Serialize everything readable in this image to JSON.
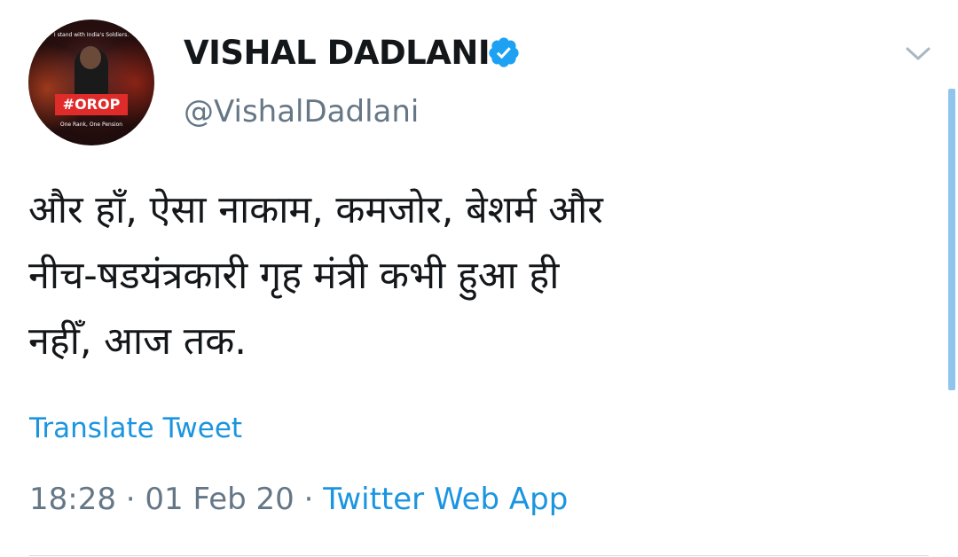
{
  "author": {
    "display_name": "VISHAL DADLANI",
    "handle": "@VishalDadlani",
    "verified": true,
    "avatar": {
      "banner_text": "I stand with India's Soldiers.",
      "tag": "#OROP",
      "subtitle": "One Rank, One Pension"
    }
  },
  "tweet": {
    "lines": [
      "और हाँ, ऐसा नाकाम, कमजोर, बेशर्म और",
      "नीच-षडयंत्रकारी गृह मंत्री कभी हुआ ही",
      "नहीँ, आज तक."
    ],
    "translate_label": "Translate Tweet",
    "time": "18:28",
    "date": "01 Feb 20",
    "separator": "·",
    "source": "Twitter Web App"
  },
  "colors": {
    "text": "#14171a",
    "muted": "#657786",
    "link": "#1b95e0",
    "verified": "#1da1f2",
    "divider": "#d5dbe0"
  },
  "icons": {
    "verified": "verified-badge-icon",
    "more": "chevron-down-icon"
  }
}
